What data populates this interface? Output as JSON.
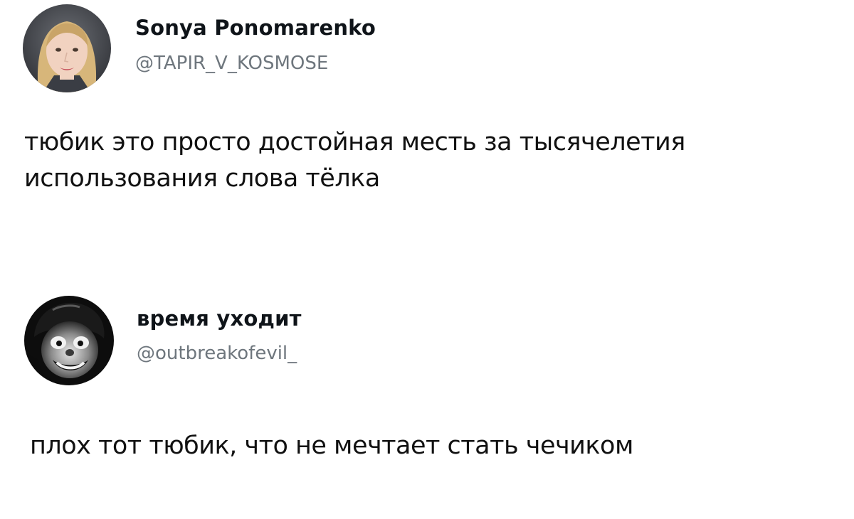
{
  "tweets": [
    {
      "author": {
        "display_name": "Sonya Ponomarenko",
        "handle": "@TAPIR_V_KOSMOSE",
        "avatar_icon": "user-avatar-photo"
      },
      "text": "тюбик это просто достойная месть за тысячелетия\nиспользования слова тёлка"
    },
    {
      "author": {
        "display_name": "время уходит",
        "handle": "@outbreakofevil_",
        "avatar_icon": "clown-avatar-photo"
      },
      "text": "плох тот тюбик, что не мечтает стать чечиком"
    }
  ],
  "colors": {
    "background": "#ffffff",
    "text": "#111111",
    "handle": "#6e767d"
  }
}
